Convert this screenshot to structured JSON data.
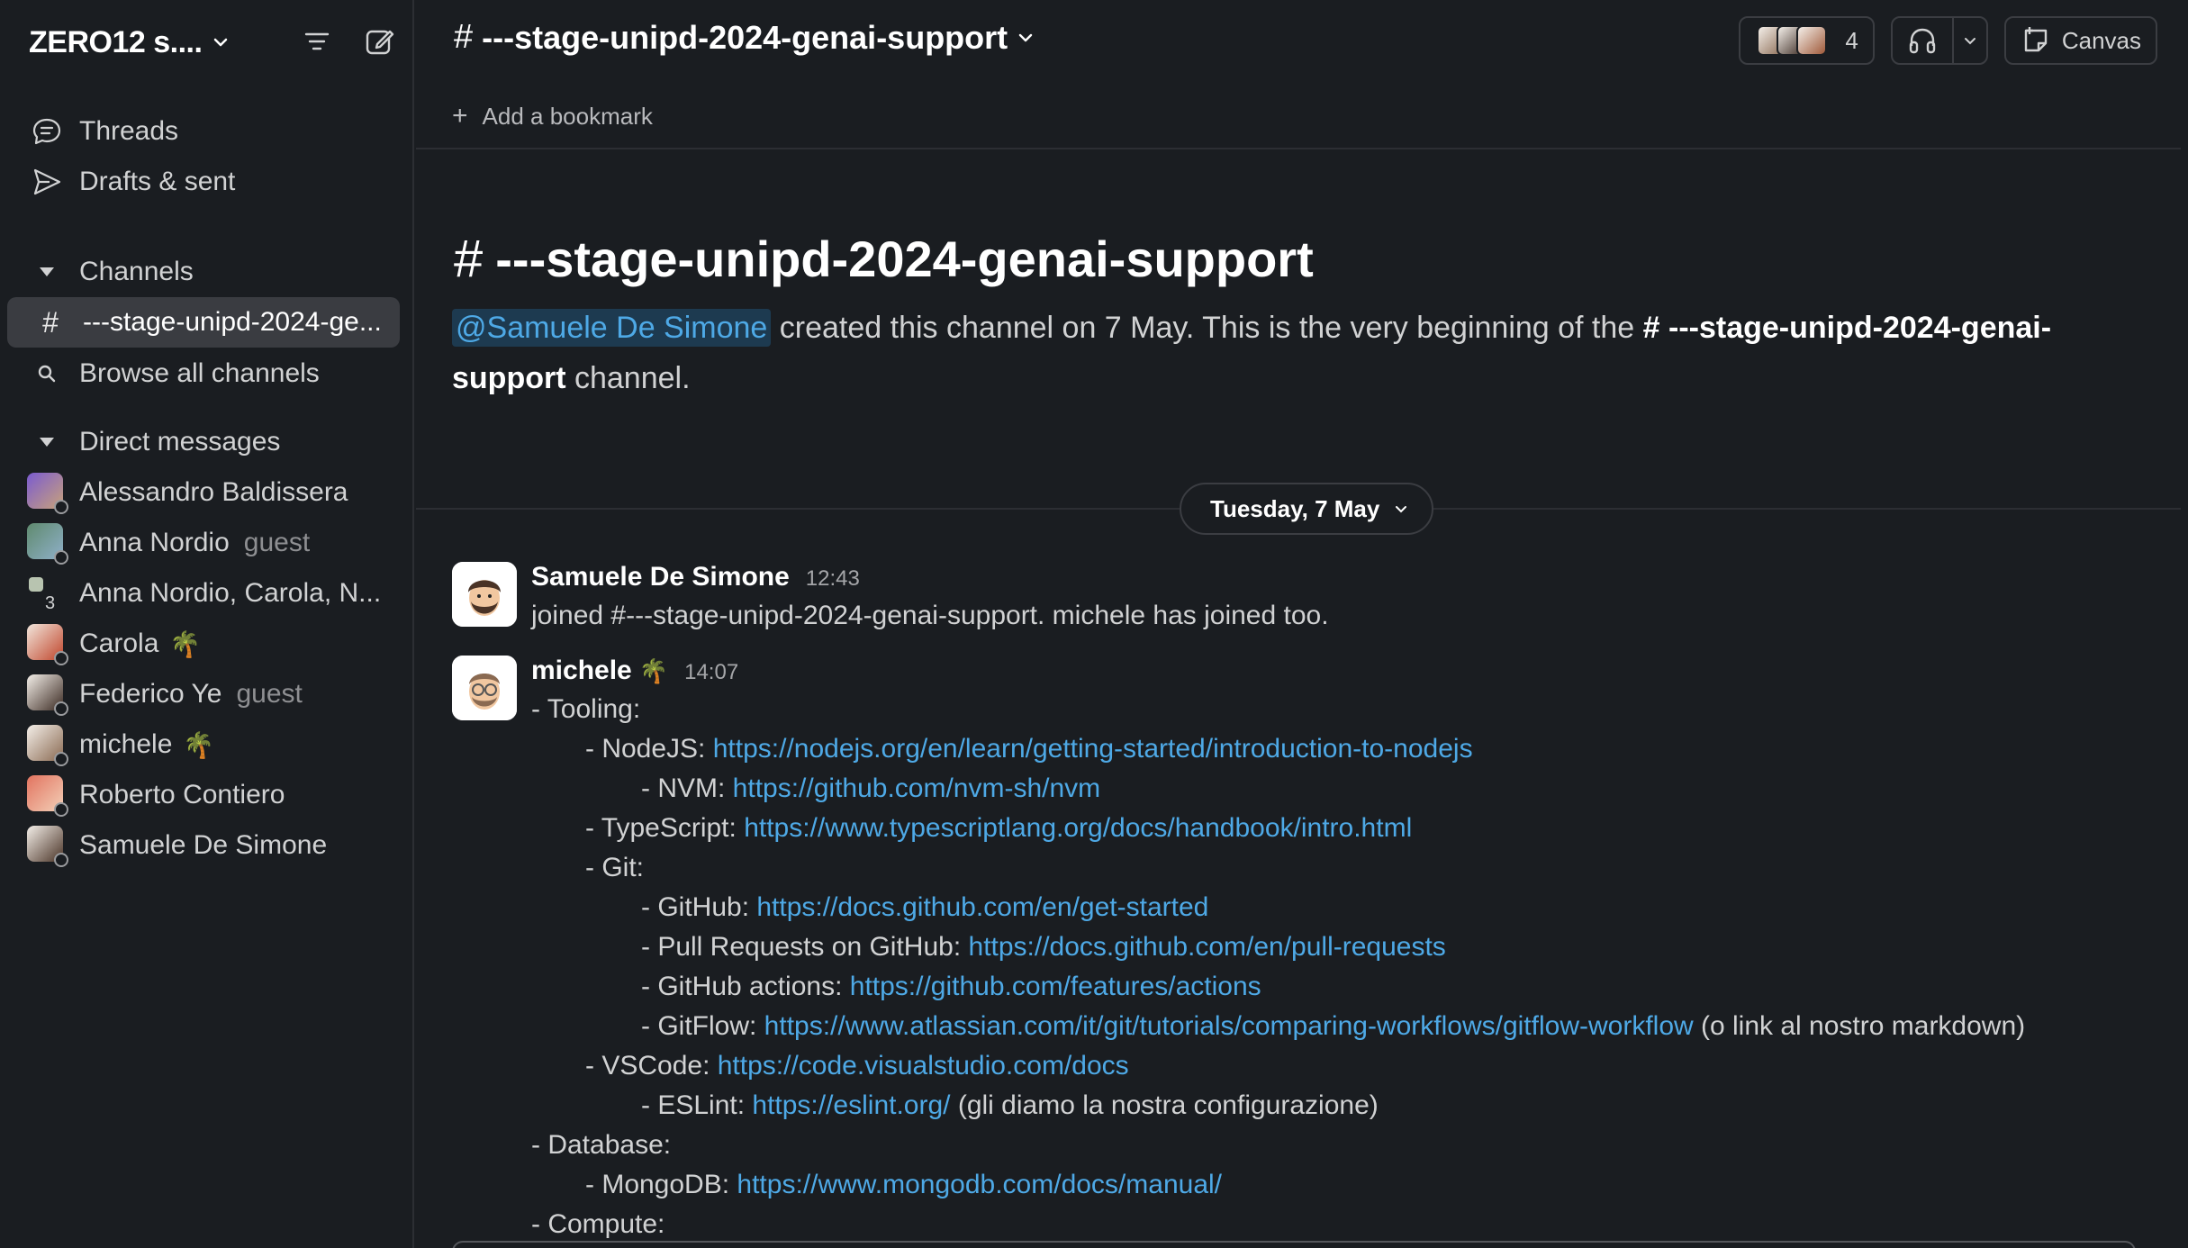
{
  "workspace": {
    "name": "ZERO12 s....",
    "filter_icon": "filter-icon",
    "compose_icon": "compose-icon"
  },
  "sidebar": {
    "nav": [
      {
        "label": "Threads",
        "icon": "threads-icon"
      },
      {
        "label": "Drafts & sent",
        "icon": "send-icon"
      }
    ],
    "channels_header": "Channels",
    "channels": [
      {
        "label": "---stage-unipd-2024-ge...",
        "active": true
      }
    ],
    "browse_channels": "Browse all channels",
    "dm_header": "Direct messages",
    "dms": [
      {
        "name": "Alessandro Baldissera",
        "tag": "",
        "emoji": ""
      },
      {
        "name": "Anna Nordio",
        "tag": "guest",
        "emoji": ""
      },
      {
        "name": "Anna Nordio, Carola, N...",
        "tag": "",
        "emoji": "",
        "count": "3"
      },
      {
        "name": "Carola",
        "tag": "",
        "emoji": "🌴"
      },
      {
        "name": "Federico Ye",
        "tag": "guest",
        "emoji": ""
      },
      {
        "name": "michele",
        "tag": "",
        "emoji": "🌴"
      },
      {
        "name": "Roberto Contiero",
        "tag": "",
        "emoji": ""
      },
      {
        "name": "Samuele De Simone",
        "tag": "",
        "emoji": ""
      }
    ]
  },
  "channel": {
    "name": "---stage-unipd-2024-genai-support",
    "member_count": "4",
    "canvas_label": "Canvas",
    "add_bookmark": "Add a bookmark"
  },
  "intro": {
    "title": "---stage-unipd-2024-genai-support",
    "mention": "@Samuele De Simone",
    "text_a": " created this channel on 7 May. This is the very beginning of the ",
    "channel_bold": "# ---stage-unipd-2024-genai-support",
    "text_b": " channel."
  },
  "date_divider": "Tuesday, 7 May",
  "messages": [
    {
      "author": "Samuele De Simone",
      "time": "12:43",
      "text": "joined #---stage-unipd-2024-genai-support. michele has joined too."
    },
    {
      "author": "michele",
      "emoji": "🌴",
      "time": "14:07",
      "lines": [
        {
          "indent": 0,
          "prefix": "- Tooling:",
          "link": "",
          "suffix": ""
        },
        {
          "indent": 1,
          "prefix": "- NodeJS: ",
          "link": "https://nodejs.org/en/learn/getting-started/introduction-to-nodejs",
          "suffix": ""
        },
        {
          "indent": 2,
          "prefix": "- NVM: ",
          "link": "https://github.com/nvm-sh/nvm",
          "suffix": ""
        },
        {
          "indent": 1,
          "prefix": "- TypeScript: ",
          "link": "https://www.typescriptlang.org/docs/handbook/intro.html",
          "suffix": ""
        },
        {
          "indent": 1,
          "prefix": "- Git:",
          "link": "",
          "suffix": ""
        },
        {
          "indent": 2,
          "prefix": "- GitHub: ",
          "link": "https://docs.github.com/en/get-started",
          "suffix": ""
        },
        {
          "indent": 2,
          "prefix": "- Pull Requests on GitHub: ",
          "link": "https://docs.github.com/en/pull-requests",
          "suffix": ""
        },
        {
          "indent": 2,
          "prefix": "- GitHub actions: ",
          "link": "https://github.com/features/actions",
          "suffix": ""
        },
        {
          "indent": 2,
          "prefix": "- GitFlow: ",
          "link": "https://www.atlassian.com/it/git/tutorials/comparing-workflows/gitflow-workflow",
          "suffix": " (o link al nostro markdown)"
        },
        {
          "indent": 1,
          "prefix": "- VSCode: ",
          "link": "https://code.visualstudio.com/docs",
          "suffix": ""
        },
        {
          "indent": 2,
          "prefix": "- ESLint: ",
          "link": "https://eslint.org/",
          "suffix": " (gli diamo la nostra configurazione)"
        },
        {
          "indent": 0,
          "prefix": "- Database:",
          "link": "",
          "suffix": ""
        },
        {
          "indent": 1,
          "prefix": "- MongoDB: ",
          "link": "https://www.mongodb.com/docs/manual/",
          "suffix": ""
        },
        {
          "indent": 0,
          "prefix": "- Compute:",
          "link": "",
          "suffix": ""
        }
      ]
    }
  ],
  "colors": {
    "background": "#1a1d21",
    "link": "#4ea9e6",
    "active_item": "#3a3c41",
    "mention_bg": "#1d3a50"
  }
}
